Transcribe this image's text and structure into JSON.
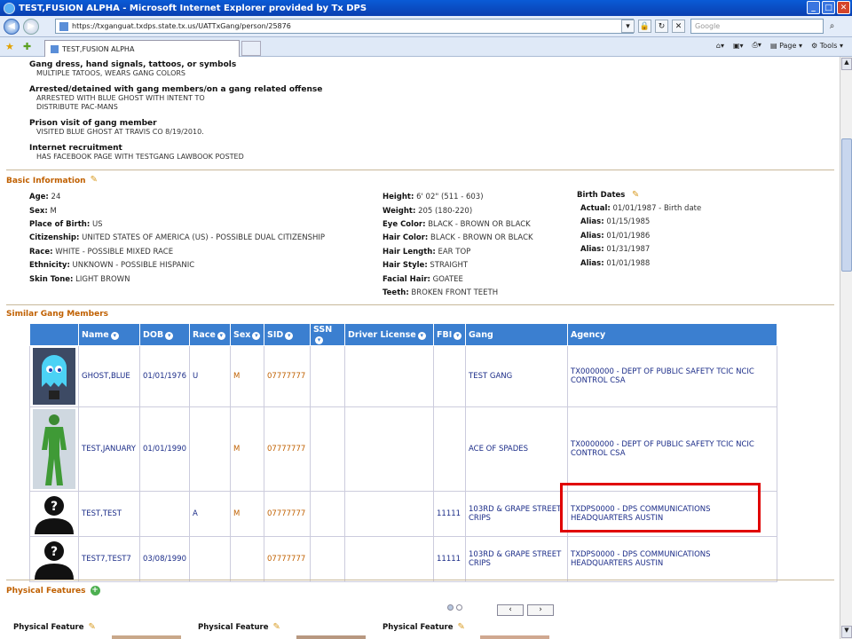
{
  "window": {
    "title": "TEST,FUSION ALPHA - Microsoft Internet Explorer provided by Tx DPS"
  },
  "address": {
    "url": "https://txganguat.txdps.state.tx.us/UATTxGang/person/25876",
    "search_placeholder": "Google"
  },
  "tab": {
    "label": "TEST,FUSION ALPHA"
  },
  "commands": {
    "page": "Page",
    "tools": "Tools"
  },
  "evidence": [
    {
      "label": "Gang dress, hand signals, tattoos, or symbols",
      "values": [
        "MULTIPLE TATOOS, WEARS GANG COLORS"
      ]
    },
    {
      "label": "Arrested/detained with gang members/on a gang related offense",
      "values": [
        "ARRESTED WITH BLUE GHOST WITH INTENT TO",
        "DISTRIBUTE PAC-MANS"
      ]
    },
    {
      "label": "Prison visit of gang member",
      "values": [
        "VISITED BLUE GHOST AT TRAVIS CO 8/19/2010."
      ]
    },
    {
      "label": "Internet recruitment",
      "values": [
        "HAS FACEBOOK PAGE WITH TESTGANG LAWBOOK POSTED"
      ]
    }
  ],
  "basic": {
    "title": "Basic Information",
    "age": {
      "k": "Age:",
      "v": "24"
    },
    "sex": {
      "k": "Sex:",
      "v": "M"
    },
    "pob": {
      "k": "Place of Birth:",
      "v": "US"
    },
    "citizenship": {
      "k": "Citizenship:",
      "v": "UNITED STATES OF AMERICA (US) - POSSIBLE DUAL CITIZENSHIP"
    },
    "race": {
      "k": "Race:",
      "v": "WHITE - POSSIBLE MIXED RACE"
    },
    "ethnicity": {
      "k": "Ethnicity:",
      "v": "UNKNOWN - POSSIBLE HISPANIC"
    },
    "skin": {
      "k": "Skin Tone:",
      "v": "LIGHT BROWN"
    },
    "height": {
      "k": "Height:",
      "v": "6' 02\" (511 - 603)"
    },
    "weight": {
      "k": "Weight:",
      "v": "205 (180-220)"
    },
    "eye": {
      "k": "Eye Color:",
      "v": "BLACK - BROWN OR BLACK"
    },
    "hair": {
      "k": "Hair Color:",
      "v": "BLACK - BROWN OR BLACK"
    },
    "hairlen": {
      "k": "Hair Length:",
      "v": "EAR TOP"
    },
    "hairstyle": {
      "k": "Hair Style:",
      "v": "STRAIGHT"
    },
    "facial": {
      "k": "Facial Hair:",
      "v": "GOATEE"
    },
    "teeth": {
      "k": "Teeth:",
      "v": "BROKEN FRONT TEETH"
    },
    "birth_dates_title": "Birth Dates",
    "birth_dates": [
      {
        "k": "Actual:",
        "v": "01/01/1987 - Birth date"
      },
      {
        "k": "Alias:",
        "v": "01/15/1985"
      },
      {
        "k": "Alias:",
        "v": "01/01/1986"
      },
      {
        "k": "Alias:",
        "v": "01/31/1987"
      },
      {
        "k": "Alias:",
        "v": "01/01/1988"
      }
    ]
  },
  "similar": {
    "title": "Similar Gang Members",
    "headers": {
      "name": "Name",
      "dob": "DOB",
      "race": "Race",
      "sex": "Sex",
      "sid": "SID",
      "ssn": "SSN",
      "dl": "Driver License",
      "fbi": "FBI",
      "gang": "Gang",
      "agency": "Agency"
    },
    "rows": [
      {
        "photo": "ghost-photo",
        "name": "GHOST,BLUE",
        "dob": "01/01/1976",
        "race": "U",
        "sex": "M",
        "sid": "07777777",
        "ssn": "",
        "dl": "",
        "fbi": "",
        "gang": "TEST GANG",
        "agency": "TX0000000 - DEPT OF PUBLIC SAFETY TCIC NCIC CONTROL CSA"
      },
      {
        "photo": "green-giant-photo",
        "name": "TEST,JANUARY",
        "dob": "01/01/1990",
        "race": "",
        "sex": "M",
        "sid": "07777777",
        "ssn": "",
        "dl": "",
        "fbi": "",
        "gang": "ACE OF SPADES",
        "agency": "TX0000000 - DEPT OF PUBLIC SAFETY TCIC NCIC CONTROL CSA"
      },
      {
        "photo": "unknown-person-photo",
        "name": "TEST,TEST",
        "dob": "",
        "race": "A",
        "sex": "M",
        "sid": "07777777",
        "ssn": "",
        "dl": "",
        "fbi": "11111",
        "gang": "103RD & GRAPE STREET CRIPS",
        "agency": "TXDPS0000 - DPS COMMUNICATIONS HEADQUARTERS AUSTIN"
      },
      {
        "photo": "unknown-person-photo",
        "name": "TEST7,TEST7",
        "dob": "03/08/1990",
        "race": "",
        "sex": "",
        "sid": "07777777",
        "ssn": "",
        "dl": "",
        "fbi": "11111",
        "gang": "103RD & GRAPE STREET CRIPS",
        "agency": "TXDPS0000 - DPS COMMUNICATIONS HEADQUARTERS AUSTIN"
      }
    ]
  },
  "physical": {
    "title": "Physical Features",
    "card_label": "Physical Feature"
  },
  "colors": {
    "accent": "#3b7fd0",
    "section": "#c06000",
    "highlight": "#e00000",
    "link": "#1b2c88"
  }
}
